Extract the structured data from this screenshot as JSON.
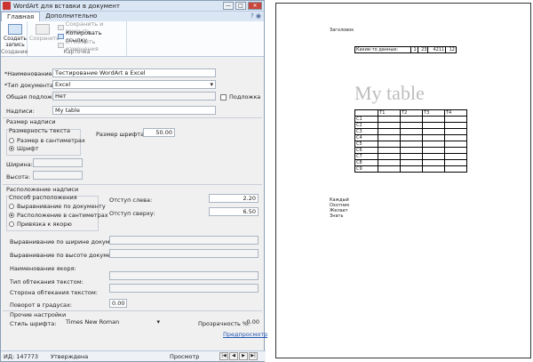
{
  "window": {
    "title": "WordArt для вставки в документ",
    "btn_min": "—",
    "btn_max": "□",
    "btn_close": "✕"
  },
  "tabs": [
    {
      "label": "Главная"
    },
    {
      "label": "Дополнительно"
    }
  ],
  "tab_controls": "? ◉",
  "ribbon": {
    "create_label": "Создать запись",
    "create_group": "Создание",
    "save_label": "Сохранить",
    "save_close": "Сохранить и закрыть",
    "copy_link": "Копировать ссылку",
    "cancel_changes": "Отменить изменения",
    "card_group": "Карточка"
  },
  "form": {
    "name_label": "*Наименование:",
    "name_value": "Тестирование WordArt в Excel",
    "doctype_label": "*Тип документа:",
    "doctype_value": "Excel",
    "bg_label": "Общая подложка:",
    "bg_value": "Нет",
    "bg_check_label": "Подложка",
    "caption_label": "Надписи:",
    "caption_value": "My table",
    "size_section": "Размер надписи",
    "dim_group": "Размерность текста",
    "dim_cm": "Размер в сантиметрах",
    "dim_font": "Шрифт",
    "font_size_label": "Размер шрифта:",
    "font_size_value": "50.00",
    "width_label": "Ширина:",
    "height_label": "Высота:",
    "loc_section": "Расположение надписи",
    "loc_group": "Способ расположения",
    "loc_doc": "Выравнивание по документу",
    "loc_cm": "Расположение в сантиметрах",
    "loc_anchor": "Привязка к якорю",
    "left_label": "Отступ слева:",
    "left_value": "2.20",
    "top_label": "Отступ сверху:",
    "top_value": "6.50",
    "align_w_label": "Выравнивание по ширине документа:",
    "align_h_label": "Выравнивание по высоте документа:",
    "anchor_name_label": "Наименование якоря:",
    "wrap_type_label": "Тип обтекания текстом:",
    "wrap_side_label": "Сторона обтекания текстом:",
    "rotation_label": "Поворот в градусах:",
    "rotation_value": "0.00",
    "other_section": "Прочие настройки",
    "font_style_label": "Стиль шрифта:",
    "font_style_value": "Times New Roman",
    "transp_label": "Прозрачность %:",
    "transp_value": "0.00",
    "preview_link": "Предпросмотр"
  },
  "status": {
    "id": "ИД: 147773",
    "state": "Утверждена",
    "mode": "Просмотр"
  },
  "preview": {
    "header": "Заголовок",
    "wordart": "My table",
    "small_table": [
      [
        "Какие-то данные:",
        "1",
        "23",
        "4211",
        "12"
      ]
    ],
    "grid_header": [
      "",
      "T1",
      "T2",
      "T3",
      "T4"
    ],
    "grid_rows": [
      "C1",
      "C2",
      "C3",
      "C4",
      "C5",
      "C6",
      "C7",
      "C8",
      "C9"
    ],
    "footer_lines": [
      "Каждый",
      "Охотник",
      "Желает",
      "Знать"
    ]
  }
}
